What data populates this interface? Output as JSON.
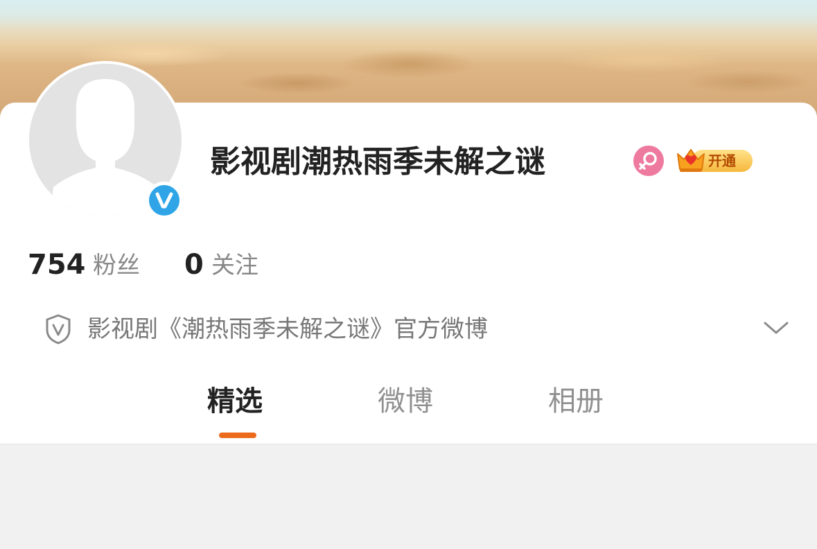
{
  "profile": {
    "name": "影视剧潮热雨季未解之谜",
    "gender_icon": "female-icon",
    "vip": {
      "icon": "crown-icon",
      "label": "开通"
    },
    "verified_icon": "verified-v-icon"
  },
  "stats": [
    {
      "count": "754",
      "label": "粉丝"
    },
    {
      "count": "0",
      "label": "关注"
    }
  ],
  "verification": {
    "icon": "shield-v-icon",
    "text": "影视剧《潮热雨季未解之谜》官方微博",
    "expand_icon": "chevron-down-icon"
  },
  "tabs": [
    {
      "label": "精选",
      "active": true
    },
    {
      "label": "微博",
      "active": false
    },
    {
      "label": "相册",
      "active": false
    }
  ],
  "colors": {
    "accent": "#ec6a1c",
    "verified_blue": "#2fa5e8",
    "female_pink": "#ee7aa0",
    "vip_gold": "#f6b83d"
  }
}
